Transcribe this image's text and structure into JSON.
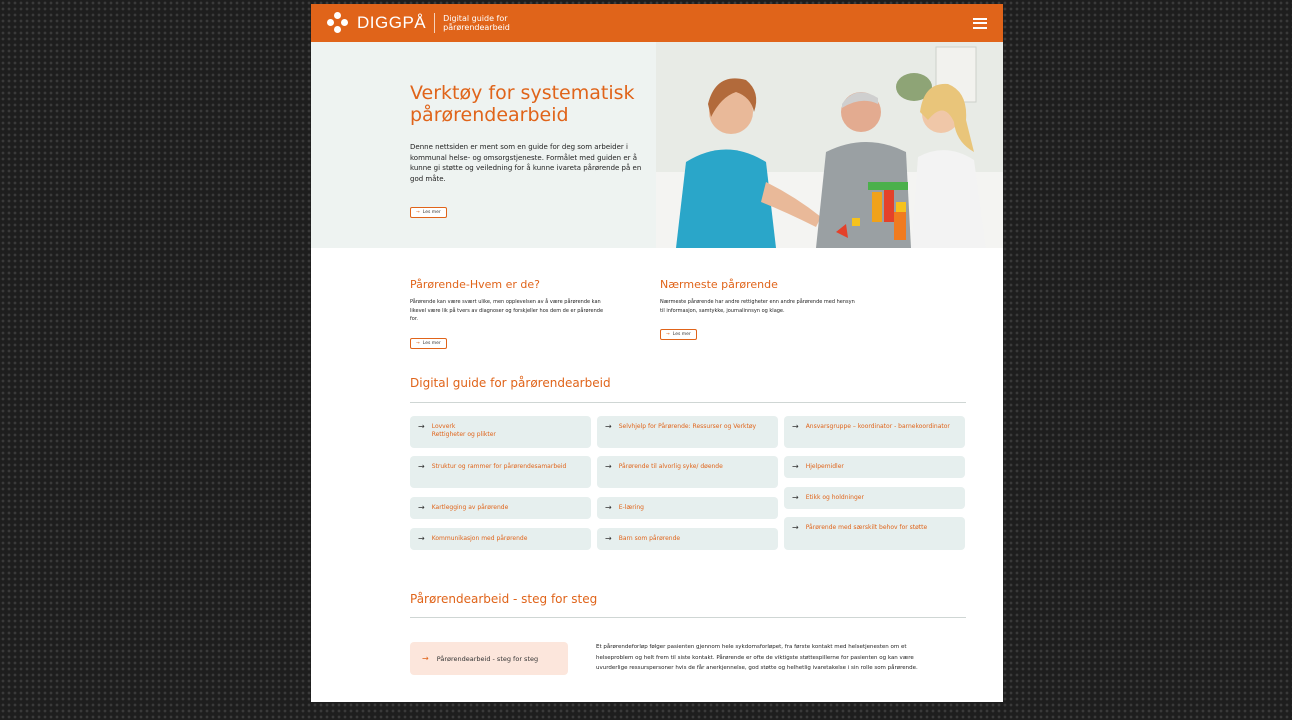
{
  "header": {
    "logo_text": "DIGGPÅ",
    "tagline": "Digital guide for pårørendearbeid",
    "brand_color": "#e0641a",
    "menu_icon": "hamburger-icon"
  },
  "hero": {
    "title": "Verktøy for systematisk pårørendearbeid",
    "text": "Denne nettsiden er ment som en guide for deg som arbeider i kommunal helse- og omsorgstjeneste. Formålet med guiden er å kunne gi støtte og veiledning for å kunne ivareta pårørende på en god måte.",
    "button": "Les mer"
  },
  "info": [
    {
      "title": "Pårørende-Hvem er de?",
      "text": "Pårørende kan være svært ulike, men opplevelsen av å være pårørende kan likevel være lik på tvers av diagnoser og forskjeller hos dem de er pårørende for.",
      "button": "Les mer"
    },
    {
      "title": "Nærmeste pårørende",
      "text": "Nærmeste pårørende har andre rettigheter enn andre pårørende med hensyn til informasjon, samtykke, journalinnsyn og klage.",
      "button": "Les mer"
    }
  ],
  "guide": {
    "title": "Digital guide for pårørendearbeid",
    "col1": [
      "Lovverk\nRettigheter og plikter",
      "Struktur og rammer for pårørendesamarbeid",
      "Kartlegging av pårørende",
      "Kommunikasjon med pårørende"
    ],
    "col2": [
      "Selvhjelp for Pårørende: Ressurser og Verktøy",
      "Pårørende til alvorlig syke/ døende",
      "E-læring",
      "Barn som pårørende"
    ],
    "col3": [
      "Ansvarsgruppe – koordinator - barnekoordinator",
      "Hjelpemidler",
      "Etikk og holdninger",
      "Pårørende med særskilt behov for støtte"
    ]
  },
  "steps": {
    "title": "Pårørendearbeid  - steg for steg",
    "button": "Pårørendearbeid  - steg for steg",
    "text": "Et pårørendeforløp følger pasienten gjennom hele sykdomsforløpet, fra første kontakt med helsetjenesten om et helseproblem og helt frem til siste kontakt. Pårørende er ofte de viktigste støttespillerne for pasienten og kan være uvurderlige ressurspersoner hvis de får anerkjennelse, god støtte og helhetlig ivaretakelse i sin rolle som pårørende."
  }
}
